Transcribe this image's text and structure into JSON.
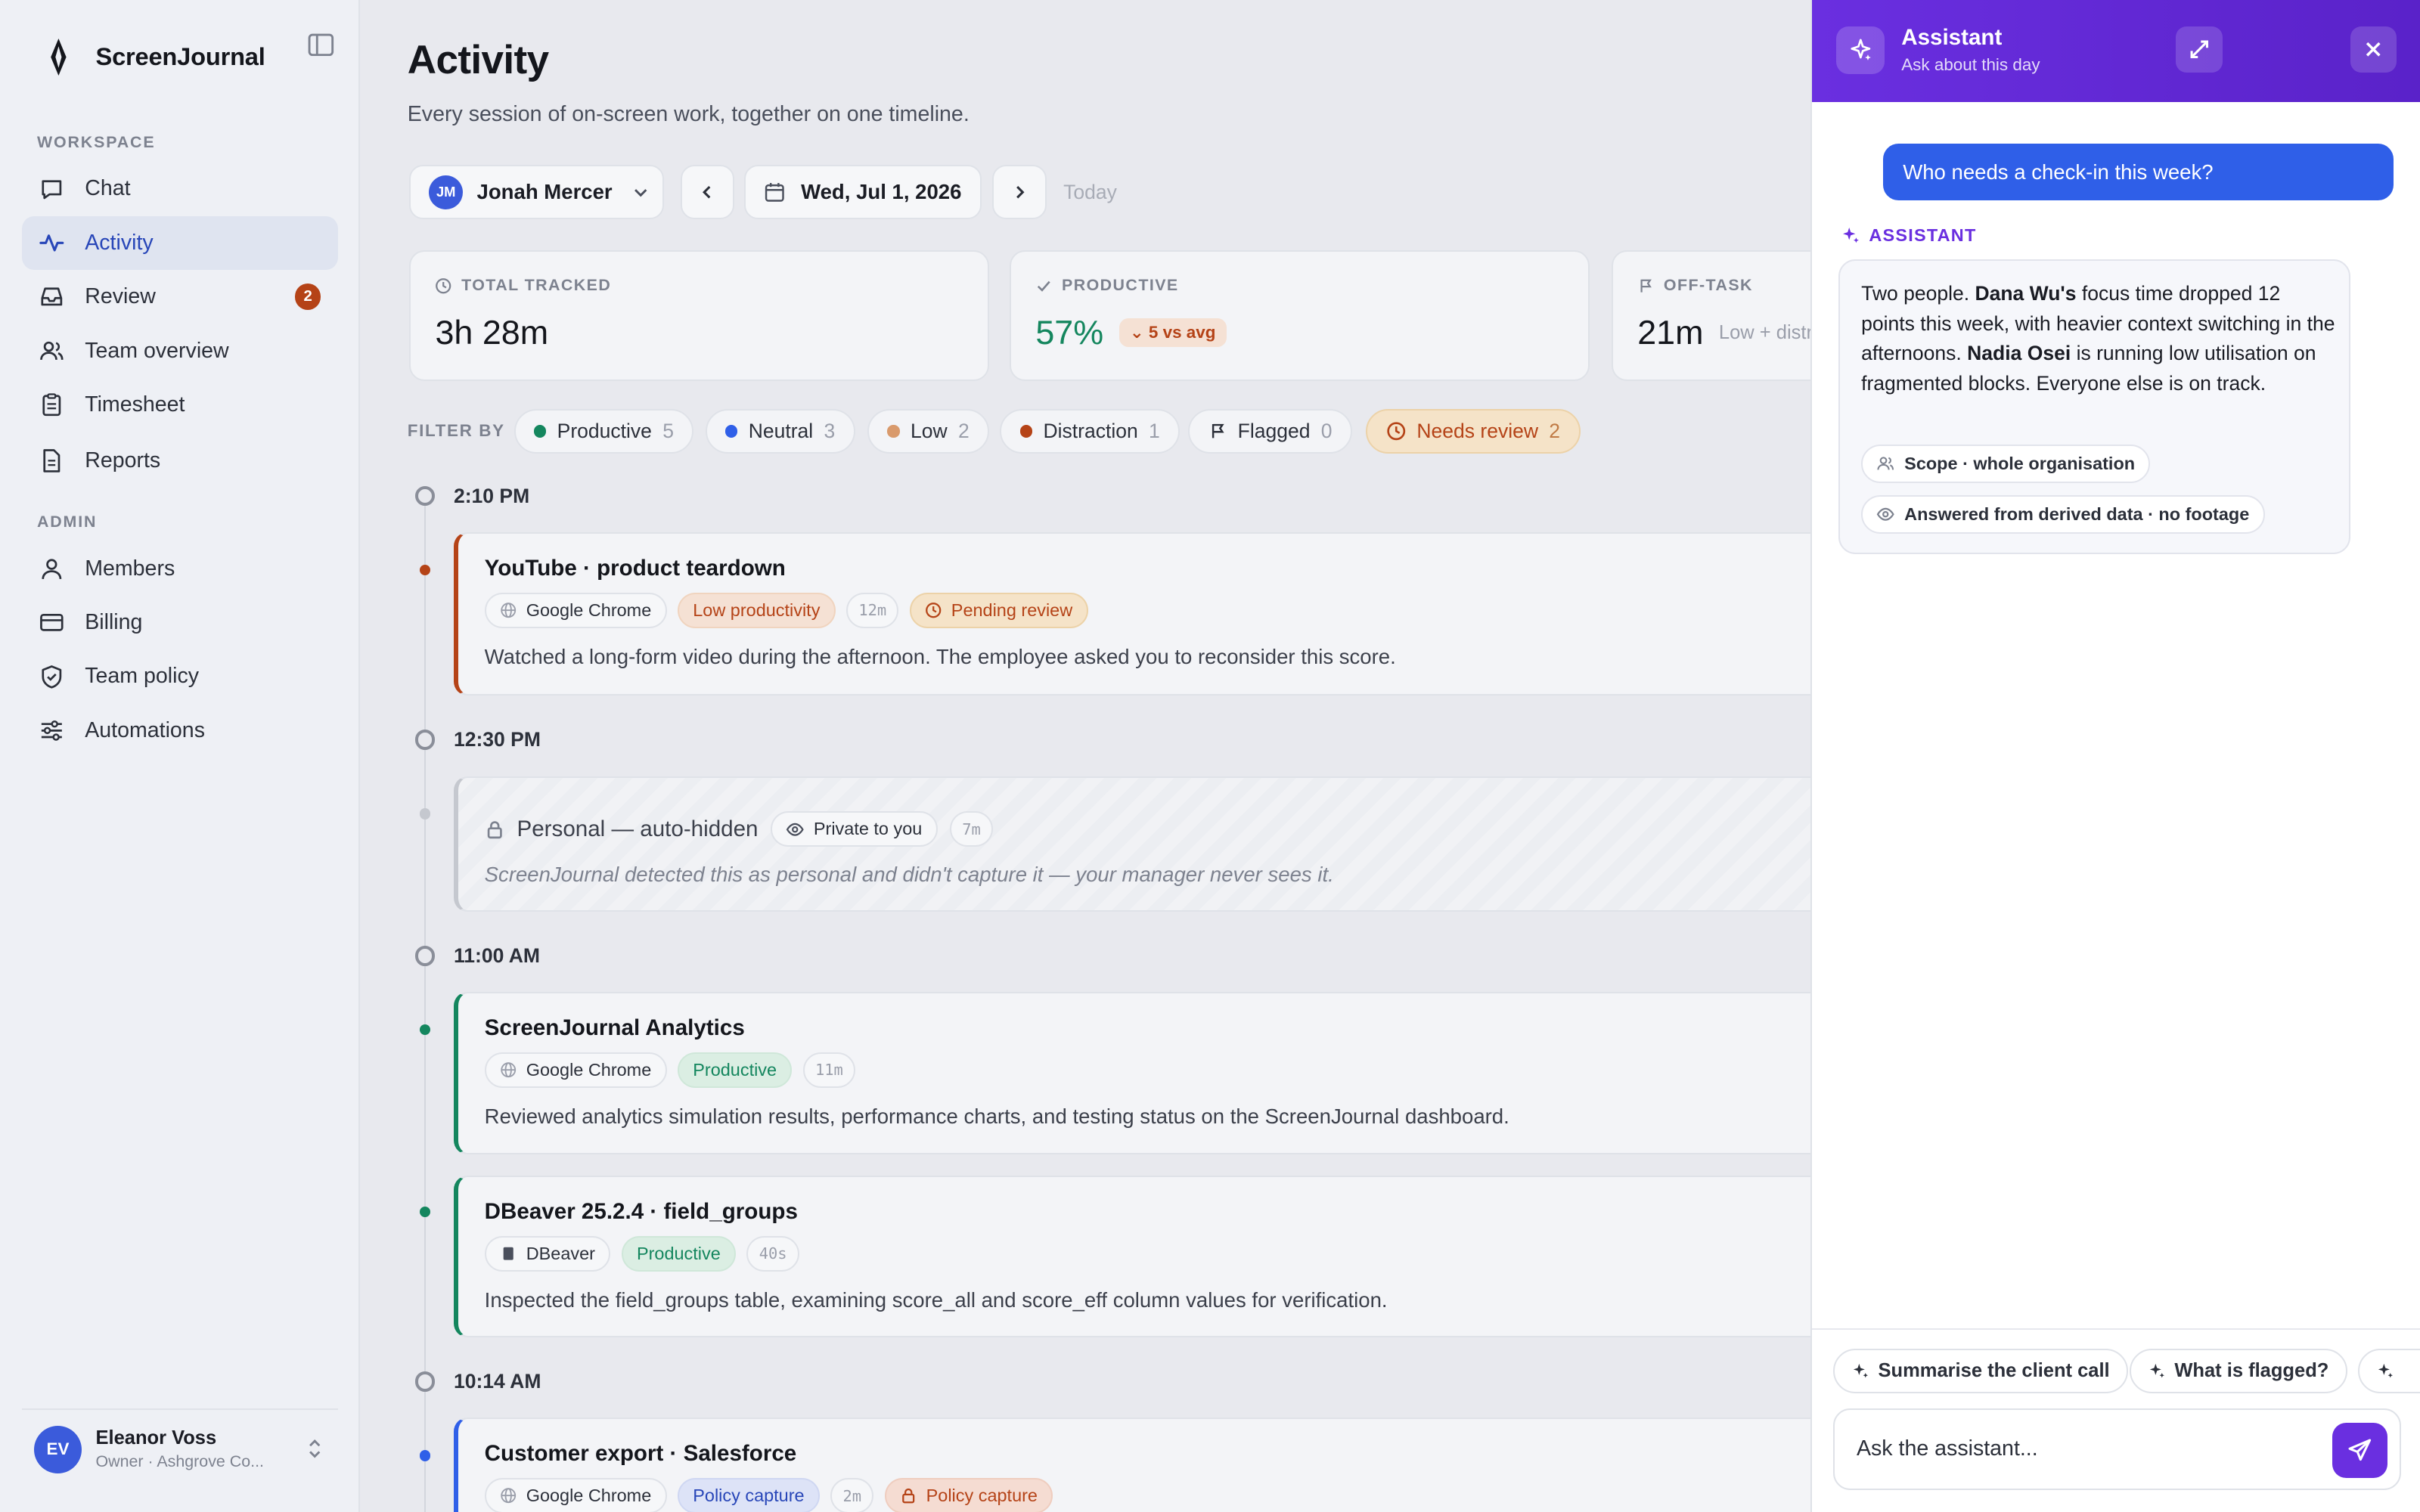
{
  "brand": {
    "name": "ScreenJournal"
  },
  "sidebar": {
    "workspace_label": "WORKSPACE",
    "admin_label": "ADMIN",
    "workspace_items": [
      {
        "label": "Chat",
        "icon": "chat-icon"
      },
      {
        "label": "Activity",
        "icon": "activity-icon",
        "active": true
      },
      {
        "label": "Review",
        "icon": "inbox-icon",
        "badge": "2"
      },
      {
        "label": "Team overview",
        "icon": "users-icon"
      },
      {
        "label": "Timesheet",
        "icon": "clipboard-icon"
      },
      {
        "label": "Reports",
        "icon": "document-icon"
      }
    ],
    "admin_items": [
      {
        "label": "Members",
        "icon": "user-icon"
      },
      {
        "label": "Billing",
        "icon": "card-icon"
      },
      {
        "label": "Team policy",
        "icon": "shield-icon"
      },
      {
        "label": "Automations",
        "icon": "sliders-icon"
      }
    ],
    "user": {
      "initials": "EV",
      "name": "Eleanor Voss",
      "role": "Owner · Ashgrove Co..."
    }
  },
  "main": {
    "title": "Activity",
    "subtitle": "Every session of on-screen work, together on one timeline.",
    "person": {
      "initials": "JM",
      "name": "Jonah Mercer"
    },
    "date": "Wed, Jul 1, 2026",
    "today_label": "Today",
    "stats": [
      {
        "label": "TOTAL TRACKED",
        "value": "3h 28m"
      },
      {
        "label": "PRODUCTIVE",
        "value": "57%",
        "delta": "5 vs avg"
      },
      {
        "label": "OFF-TASK",
        "value": "21m",
        "extra": "Low + distr"
      }
    ],
    "filter_label": "FILTER BY",
    "filters": [
      {
        "label": "Productive",
        "count": "5",
        "color": "#14865e"
      },
      {
        "label": "Neutral",
        "count": "3",
        "color": "#2f5fe8"
      },
      {
        "label": "Low",
        "count": "2",
        "color": "#d99a6c"
      },
      {
        "label": "Distraction",
        "count": "1",
        "color": "#b54317"
      },
      {
        "label": "Flagged",
        "count": "0"
      },
      {
        "label": "Needs review",
        "count": "2"
      }
    ],
    "timeline": {
      "t1": "2:10 PM",
      "t2": "12:30 PM",
      "t3": "11:00 AM",
      "t4": "10:14 AM"
    },
    "events": [
      {
        "title": "YouTube · product teardown",
        "app": "Google Chrome",
        "category": "Low productivity",
        "duration": "12m",
        "status": "Pending review",
        "desc": "Watched a long-form video during the afternoon. The employee asked you to reconsider this score."
      },
      {
        "title": "Personal — auto-hidden",
        "privacy": "Private to you",
        "duration": "7m",
        "desc": "ScreenJournal detected this as personal and didn't capture it — your manager never sees it."
      },
      {
        "title": "ScreenJournal Analytics",
        "app": "Google Chrome",
        "category": "Productive",
        "duration": "11m",
        "desc": "Reviewed analytics simulation results, performance charts, and testing status on the ScreenJournal dashboard."
      },
      {
        "title": "DBeaver 25.2.4 · field_groups",
        "app": "DBeaver",
        "category": "Productive",
        "duration": "40s",
        "desc": "Inspected the field_groups table, examining score_all and score_eff column values for verification."
      },
      {
        "title": "Customer export · Salesforce",
        "app": "Google Chrome",
        "category": "Policy capture",
        "duration": "2m",
        "status": "Policy capture"
      }
    ]
  },
  "assistant": {
    "title": "Assistant",
    "subtitle": "Ask about this day",
    "user_message": "Who needs a check-in this week?",
    "label": "ASSISTANT",
    "reply": {
      "p1": "Two people. ",
      "name1": "Dana Wu's",
      "p2": " focus time dropped 12 points this week, with heavier context switching in the afternoons. ",
      "name2": "Nadia Osei",
      "p3": " is running low utilisation on fragmented blocks. Everyone else is on track."
    },
    "scope": "Scope · whole organisation",
    "source": "Answered from derived data · no footage",
    "suggestions": [
      "Summarise the client call",
      "What is flagged?"
    ],
    "input_placeholder": "Ask the assistant..."
  }
}
